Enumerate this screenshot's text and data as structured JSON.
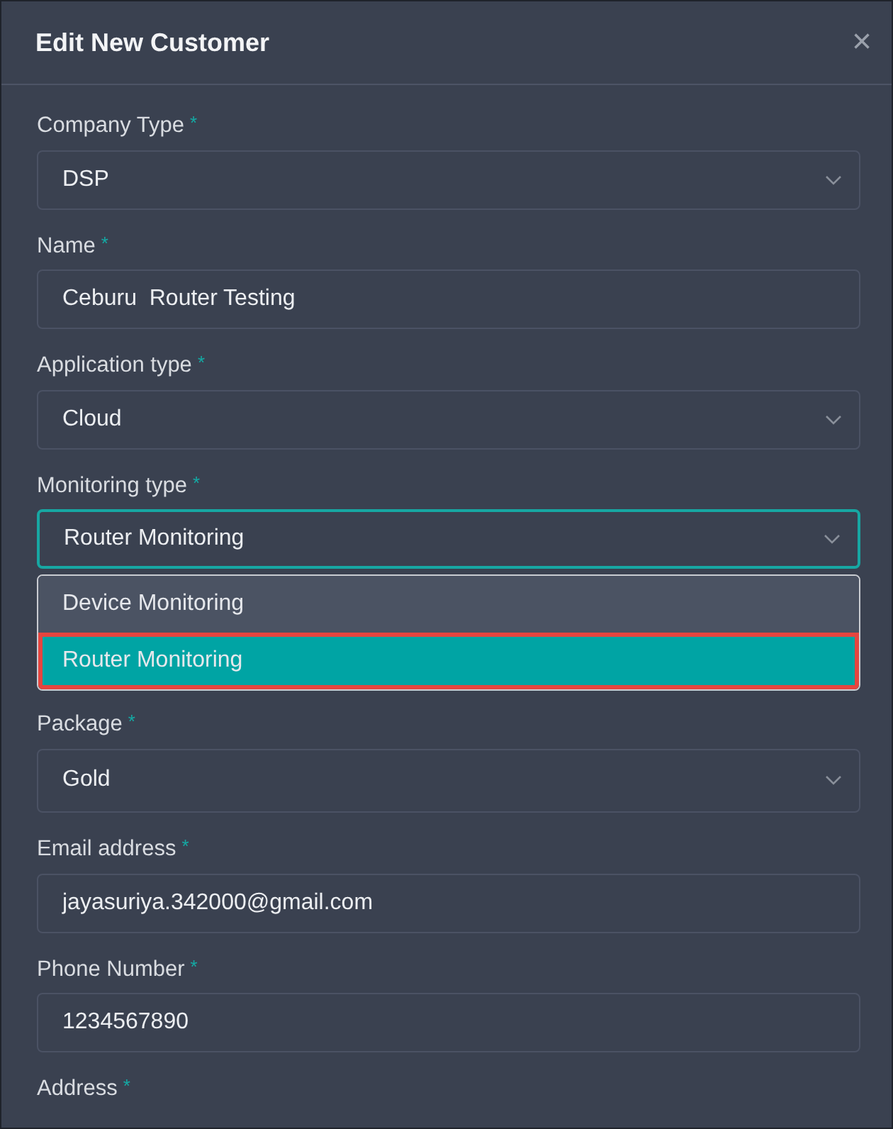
{
  "dialog": {
    "title": "Edit New Customer",
    "close": "×"
  },
  "fields": [
    {
      "label": "Company Type",
      "required_mark": "*",
      "kind": "select",
      "value": "DSP",
      "focused": false
    },
    {
      "label": "Name",
      "required_mark": "*",
      "kind": "text",
      "value": "Ceburu  Router Testing",
      "focused": false
    },
    {
      "label": "Application type",
      "required_mark": "*",
      "kind": "select",
      "value": "Cloud",
      "focused": false
    },
    {
      "label": "Monitoring type",
      "required_mark": "*",
      "kind": "select",
      "value": "Router Monitoring",
      "focused": true,
      "options": [
        {
          "label": "Device Monitoring",
          "selected": false
        },
        {
          "label": "Router Monitoring",
          "selected": true
        }
      ]
    },
    {
      "label": "Package",
      "required_mark": "*",
      "kind": "select",
      "value": "Gold",
      "focused": false
    },
    {
      "label": "Email address",
      "required_mark": "*",
      "kind": "text",
      "value": "jayasuriya.342000@gmail.com",
      "focused": false
    },
    {
      "label": "Phone Number",
      "required_mark": "*",
      "kind": "text",
      "value": "1234567890",
      "focused": false
    },
    {
      "label": "Address",
      "required_mark": "*",
      "kind": "label"
    }
  ]
}
